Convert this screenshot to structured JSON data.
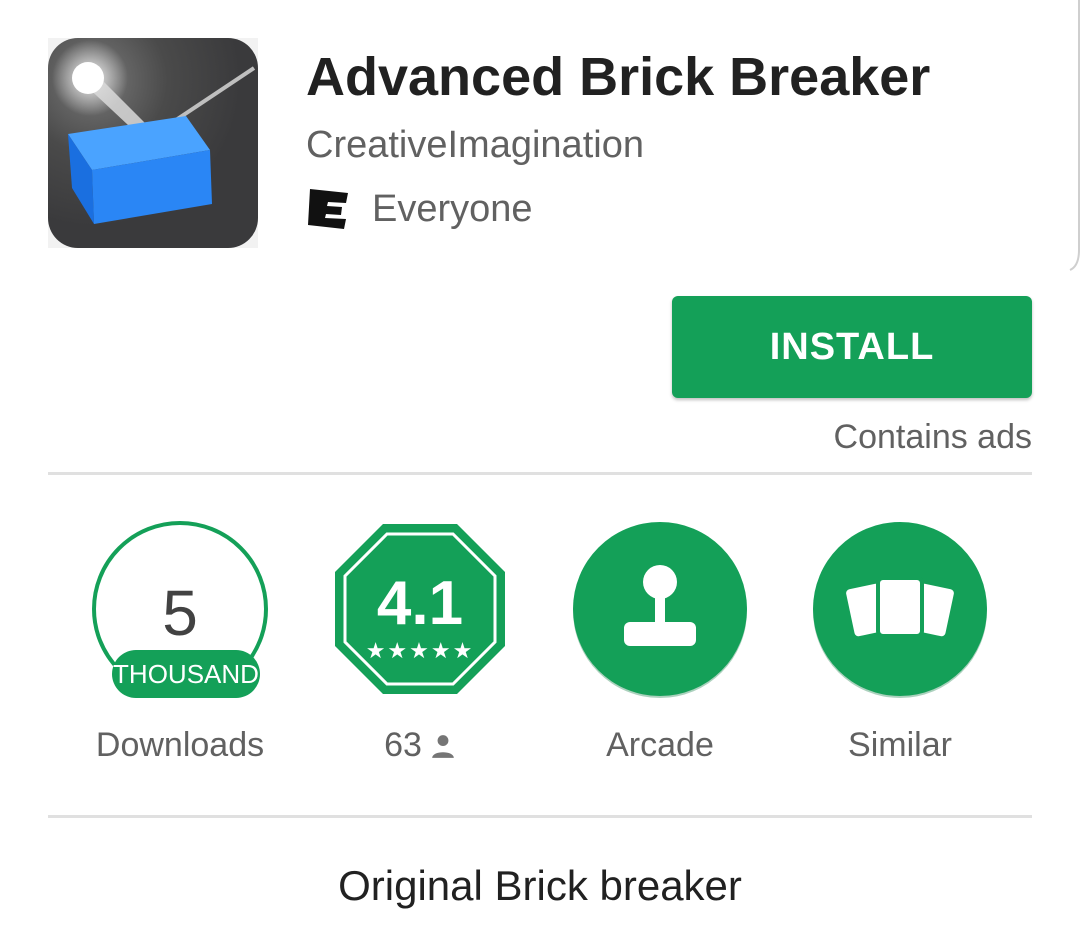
{
  "app": {
    "title": "Advanced Brick Breaker",
    "developer": "CreativeImagination",
    "content_rating": "Everyone",
    "install_label": "INSTALL",
    "ads_note": "Contains ads"
  },
  "stats": {
    "downloads": {
      "number": "5",
      "unit": "THOUSAND",
      "label": "Downloads"
    },
    "rating": {
      "value": "4.1",
      "stars": "★★★★★",
      "count": "63"
    },
    "category": {
      "label": "Arcade"
    },
    "similar": {
      "label": "Similar"
    }
  },
  "description": "Original Brick breaker",
  "colors": {
    "accent": "#14a058",
    "text_primary": "#212121",
    "text_secondary": "#616161"
  },
  "icons": [
    "app-icon",
    "esrb-everyone-icon",
    "joystick-icon",
    "similar-cards-icon",
    "person-icon"
  ]
}
